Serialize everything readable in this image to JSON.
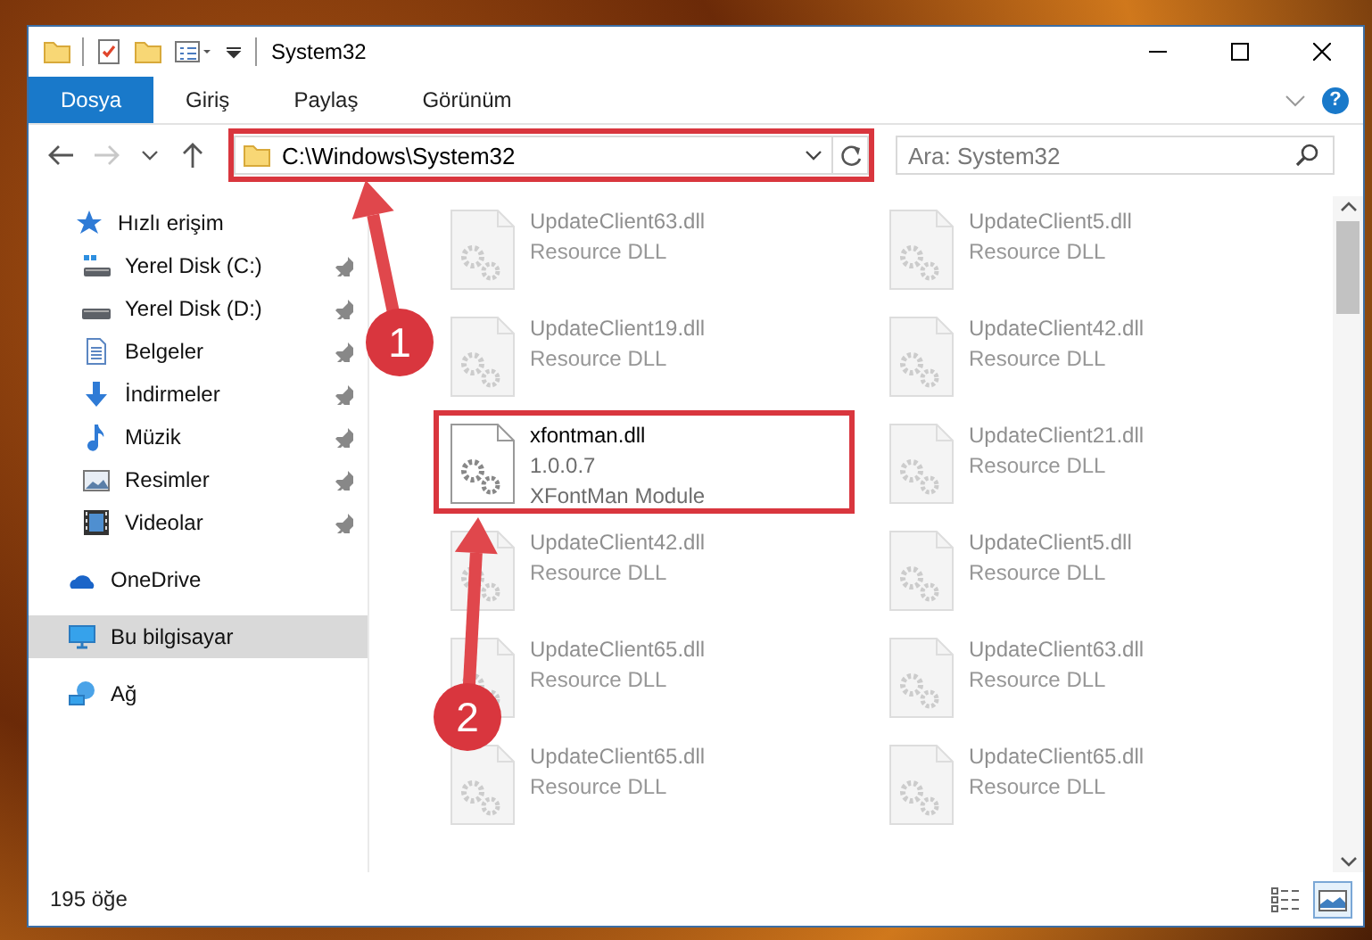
{
  "window": {
    "title": "System32"
  },
  "ribbon_tabs": [
    {
      "label": "Dosya",
      "selected": true
    },
    {
      "label": "Giriş",
      "selected": false
    },
    {
      "label": "Paylaş",
      "selected": false
    },
    {
      "label": "Görünüm",
      "selected": false
    }
  ],
  "help_button": {
    "label": "?"
  },
  "nav_buttons": [
    {
      "kind": "back",
      "disabled": false
    },
    {
      "kind": "forward",
      "disabled": true
    },
    {
      "kind": "recent",
      "disabled": false
    },
    {
      "kind": "up",
      "disabled": false
    }
  ],
  "address_bar": {
    "path": "C:\\Windows\\System32",
    "outlined": true
  },
  "search": {
    "placeholder": "Ara: System32"
  },
  "sidebar": {
    "items": [
      {
        "label": "Hızlı erişim",
        "kind": "star",
        "selected": false,
        "children": [
          {
            "label": "Yerel Disk (C:)",
            "kind": "drive-c",
            "pinned": true,
            "selected": false
          },
          {
            "label": "Yerel Disk (D:)",
            "kind": "drive",
            "pinned": true,
            "selected": false
          },
          {
            "label": "Belgeler",
            "kind": "document",
            "pinned": true,
            "selected": false
          },
          {
            "label": "İndirmeler",
            "kind": "download",
            "pinned": true,
            "selected": false
          },
          {
            "label": "Müzik",
            "kind": "music",
            "pinned": true,
            "selected": false
          },
          {
            "label": "Resimler",
            "kind": "picture",
            "pinned": true,
            "selected": false
          },
          {
            "label": "Videolar",
            "kind": "video",
            "pinned": true,
            "selected": false
          }
        ]
      },
      {
        "label": "OneDrive",
        "kind": "cloud",
        "selected": false
      },
      {
        "label": "Bu bilgisayar",
        "kind": "computer",
        "selected": true
      },
      {
        "label": "Ağ",
        "kind": "network",
        "selected": false
      }
    ]
  },
  "files": [
    {
      "name": "UpdateClient63.dll",
      "details": [
        "Resource DLL"
      ],
      "dimmed": true,
      "outlined": false
    },
    {
      "name": "UpdateClient5.dll",
      "details": [
        "Resource DLL"
      ],
      "dimmed": true,
      "outlined": false
    },
    {
      "name": "UpdateClient19.dll",
      "details": [
        "Resource DLL"
      ],
      "dimmed": true,
      "outlined": false
    },
    {
      "name": "UpdateClient42.dll",
      "details": [
        "Resource DLL"
      ],
      "dimmed": true,
      "outlined": false
    },
    {
      "name": "xfontman.dll",
      "details": [
        "1.0.0.7",
        "XFontMan Module"
      ],
      "dimmed": false,
      "outlined": true
    },
    {
      "name": "UpdateClient21.dll",
      "details": [
        "Resource DLL"
      ],
      "dimmed": true,
      "outlined": false
    },
    {
      "name": "UpdateClient42.dll",
      "details": [
        "Resource DLL"
      ],
      "dimmed": true,
      "outlined": false
    },
    {
      "name": "UpdateClient5.dll",
      "details": [
        "Resource DLL"
      ],
      "dimmed": true,
      "outlined": false
    },
    {
      "name": "UpdateClient65.dll",
      "details": [
        "Resource DLL"
      ],
      "dimmed": true,
      "outlined": false
    },
    {
      "name": "UpdateClient63.dll",
      "details": [
        "Resource DLL"
      ],
      "dimmed": true,
      "outlined": false
    },
    {
      "name": "UpdateClient65.dll",
      "details": [
        "Resource DLL"
      ],
      "dimmed": true,
      "outlined": false
    },
    {
      "name": "UpdateClient65.dll",
      "details": [
        "Resource DLL"
      ],
      "dimmed": true,
      "outlined": false
    }
  ],
  "status_bar": {
    "item_count": "195 öğe"
  },
  "view_buttons": [
    {
      "kind": "details",
      "selected": false
    },
    {
      "kind": "tiles",
      "selected": true
    }
  ],
  "annotations": [
    {
      "number": "1"
    },
    {
      "number": "2"
    }
  ]
}
